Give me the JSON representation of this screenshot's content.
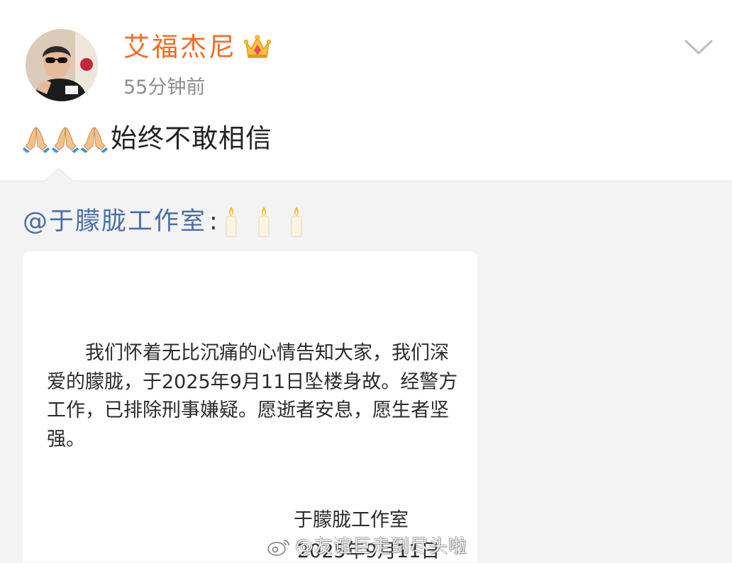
{
  "post": {
    "author": "艾福杰尼",
    "time": "55分钟前",
    "text": "始终不敢相信",
    "emoji_icons": [
      "folded-hands-icon",
      "folded-hands-icon",
      "folded-hands-icon"
    ],
    "badge_icon": "crown-icon",
    "menu_icon": "chevron-down-icon",
    "author_color": "#f86b1f"
  },
  "repost": {
    "user": "@于朦胧工作室",
    "colon": ":",
    "emoji_icons": [
      "candle-icon",
      "candle-icon",
      "candle-icon"
    ],
    "user_color": "#4a6fa5",
    "statement": {
      "paragraph": "我们怀着无比沉痛的心情告知大家，我们深爱的朦胧，于2025年9月11日坠楼身故。经警方工作，已排除刑事嫌疑。愿逝者安息，愿生者坚强。",
      "signature": "于朦胧工作室",
      "date": "2025年9月11日"
    }
  },
  "watermark": {
    "text": "@友谊巨走到尽头啦",
    "icon": "weibo-logo-icon"
  }
}
